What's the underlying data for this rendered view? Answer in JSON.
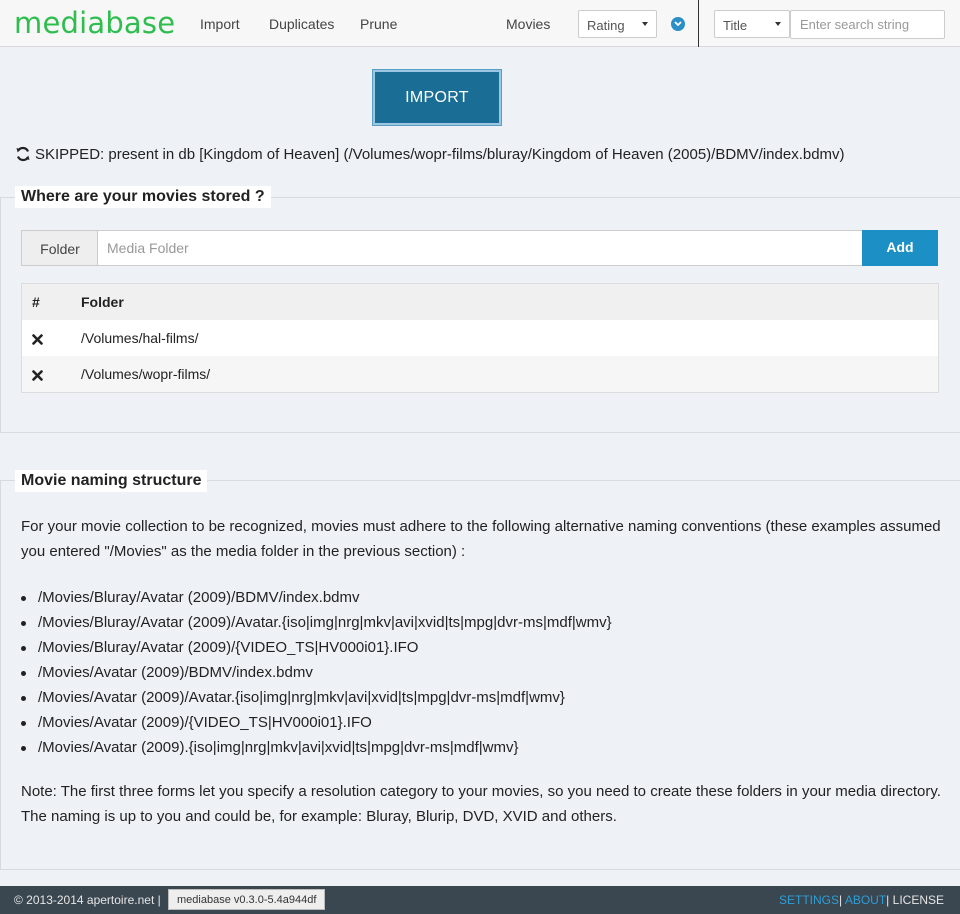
{
  "navbar": {
    "brand": "mediabase",
    "links": [
      "Import",
      "Duplicates",
      "Prune"
    ],
    "movies_label": "Movies",
    "sort_select": "Rating",
    "field_select": "Title",
    "search_placeholder": "Enter search string",
    "accent_color": "#2ebd4e"
  },
  "import": {
    "button_label": "IMPORT",
    "status": "SKIPPED: present in db [Kingdom of Heaven] (/Volumes/wopr-films/bluray/Kingdom of Heaven (2005)/BDMV/index.bdmv)"
  },
  "storage": {
    "legend": "Where are your movies stored ?",
    "folder_label": "Folder",
    "folder_placeholder": "Media Folder",
    "add_label": "Add",
    "table": {
      "headers": [
        "#",
        "Folder"
      ],
      "rows": [
        "/Volumes/hal-films/",
        "/Volumes/wopr-films/"
      ]
    }
  },
  "naming": {
    "legend": "Movie naming structure",
    "intro": "For your movie collection to be recognized, movies must adhere to the following alternative naming conventions (these examples assumed you entered \"/Movies\" as the media folder in the previous section) :",
    "examples": [
      "/Movies/Bluray/Avatar (2009)/BDMV/index.bdmv",
      "/Movies/Bluray/Avatar (2009)/Avatar.{iso|img|nrg|mkv|avi|xvid|ts|mpg|dvr-ms|mdf|wmv}",
      "/Movies/Bluray/Avatar (2009)/{VIDEO_TS|HV000i01}.IFO",
      "/Movies/Avatar (2009)/BDMV/index.bdmv",
      "/Movies/Avatar (2009)/Avatar.{iso|img|nrg|mkv|avi|xvid|ts|mpg|dvr-ms|mdf|wmv}",
      "/Movies/Avatar (2009)/{VIDEO_TS|HV000i01}.IFO",
      "/Movies/Avatar (2009).{iso|img|nrg|mkv|avi|xvid|ts|mpg|dvr-ms|mdf|wmv}"
    ],
    "note": "Note: The first three forms let you specify a resolution category to your movies, so you need to create these folders in your media directory. The naming is up to you and could be, for example: Bluray, Blurip, DVD, XVID and others."
  },
  "footer": {
    "copyright": "© 2013-2014 apertoire.net |",
    "version": "mediabase v0.3.0-5.4a944df",
    "settings": "SETTINGS",
    "about": "ABOUT",
    "license": "LICENSE",
    "separator": "|"
  }
}
